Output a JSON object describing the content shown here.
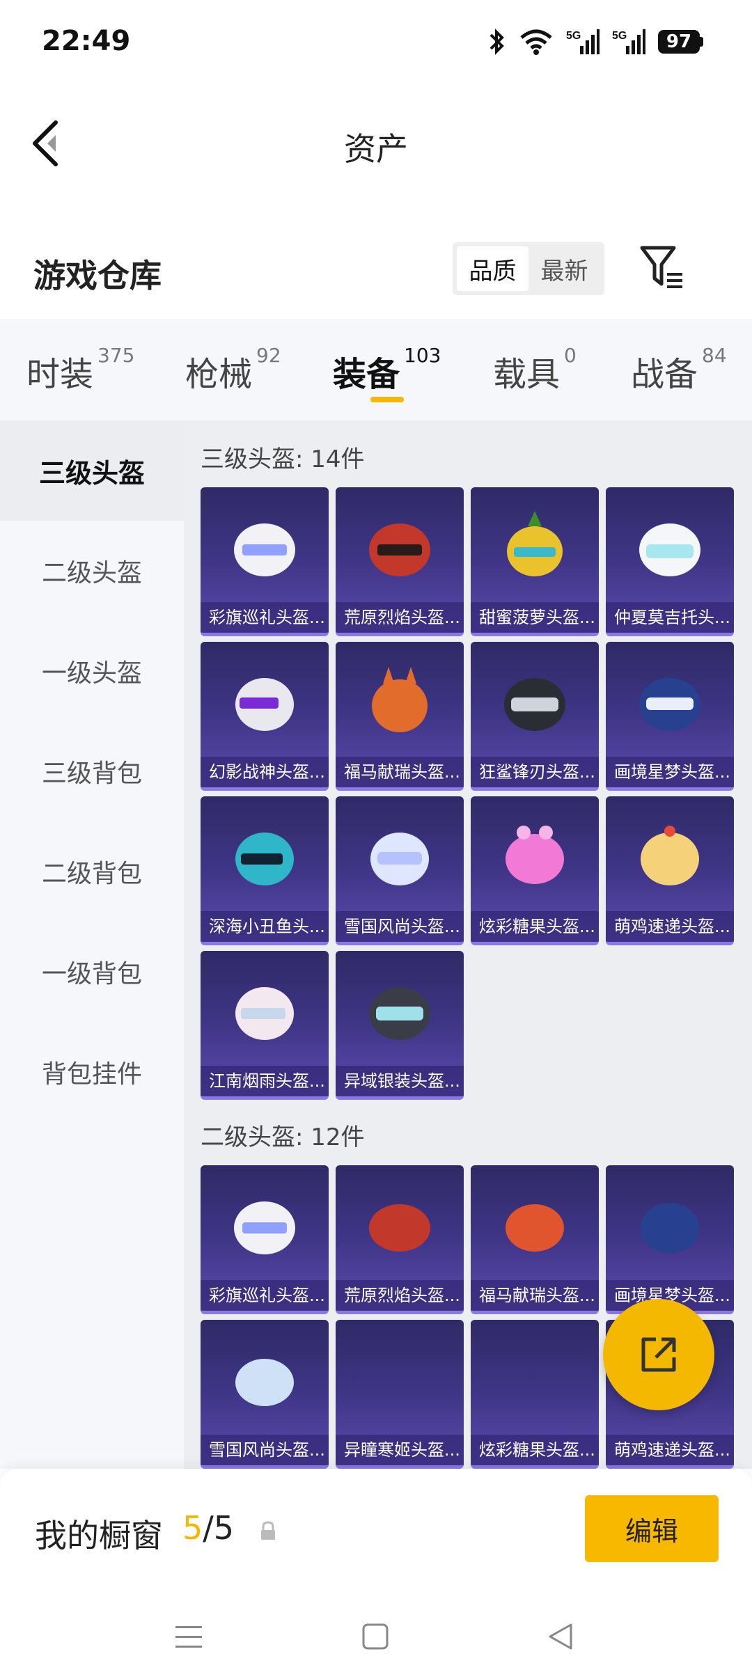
{
  "status_bar": {
    "time": "22:49",
    "battery": "97",
    "signal1_label": "5G",
    "signal2_label": "5G"
  },
  "header": {
    "title": "资产"
  },
  "warehouse": {
    "title": "游戏仓库",
    "sort_options": [
      "品质",
      "最新"
    ],
    "active_sort": "品质"
  },
  "tabs": [
    {
      "label": "时装",
      "count": "375"
    },
    {
      "label": "枪械",
      "count": "92"
    },
    {
      "label": "装备",
      "count": "103"
    },
    {
      "label": "载具",
      "count": "0"
    },
    {
      "label": "战备",
      "count": "84"
    }
  ],
  "active_tab": "装备",
  "categories": [
    "三级头盔",
    "二级头盔",
    "一级头盔",
    "三级背包",
    "二级背包",
    "一级背包",
    "背包挂件"
  ],
  "active_category": "三级头盔",
  "sections": [
    {
      "title": "三级头盔: 14件",
      "items": [
        "彩旗巡礼头盔...",
        "荒原烈焰头盔...",
        "甜蜜菠萝头盔...",
        "仲夏莫吉托头...",
        "幻影战神头盔...",
        "福马献瑞头盔...",
        "狂鲨锋刃头盔...",
        "画境星梦头盔...",
        "深海小丑鱼头...",
        "雪国风尚头盔...",
        "炫彩糖果头盔...",
        "萌鸡速递头盔...",
        "江南烟雨头盔...",
        "异域银装头盔..."
      ]
    },
    {
      "title": "二级头盔: 12件",
      "items": [
        "彩旗巡礼头盔...",
        "荒原烈焰头盔...",
        "福马献瑞头盔...",
        "画境星梦头盔...",
        "雪国风尚头盔...",
        "异瞳寒姬头盔...",
        "炫彩糖果头盔...",
        "萌鸡速递头盔..."
      ]
    }
  ],
  "showcase": {
    "label": "我的橱窗",
    "current": "5",
    "separator": "/",
    "total": "5",
    "edit_label": "编辑"
  },
  "colors": {
    "accent": "#f5b800",
    "card_bg": "#3f3586"
  },
  "icons": [
    "back-icon",
    "filter-icon",
    "lock-icon",
    "share-icon",
    "bluetooth-icon",
    "wifi-icon",
    "signal-icon",
    "menu-icon",
    "home-icon",
    "back-nav-icon"
  ]
}
